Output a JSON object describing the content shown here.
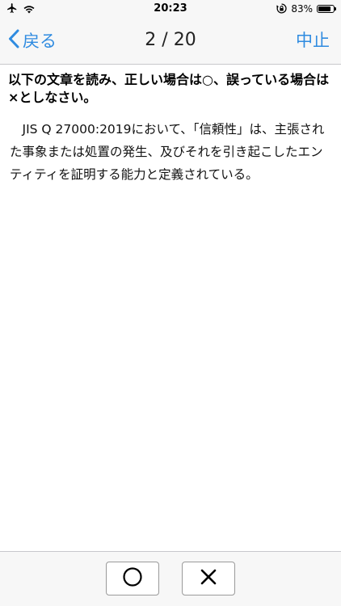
{
  "status_bar": {
    "time": "20:23",
    "battery_percent": "83%",
    "battery_level": 0.83,
    "icons": [
      "airplane-icon",
      "wifi-icon",
      "orientation-lock-icon",
      "battery-icon"
    ]
  },
  "nav": {
    "back_label": "戻る",
    "title": "2 / 20",
    "stop_label": "中止"
  },
  "content": {
    "instruction": "以下の文章を読み、正しい場合は○、誤っている場合は×としなさい。",
    "question": "JIS Q 27000:2019において、「信頼性」は、主張された事象または処置の発生、及びそれを引き起こしたエンティティを証明する能力と定義されている。"
  },
  "answers": {
    "true_icon": "circle-icon",
    "false_icon": "cross-icon"
  },
  "colors": {
    "accent": "#2f8be0",
    "bar_background": "#f7f7f7",
    "separator": "#c8c8cc"
  }
}
